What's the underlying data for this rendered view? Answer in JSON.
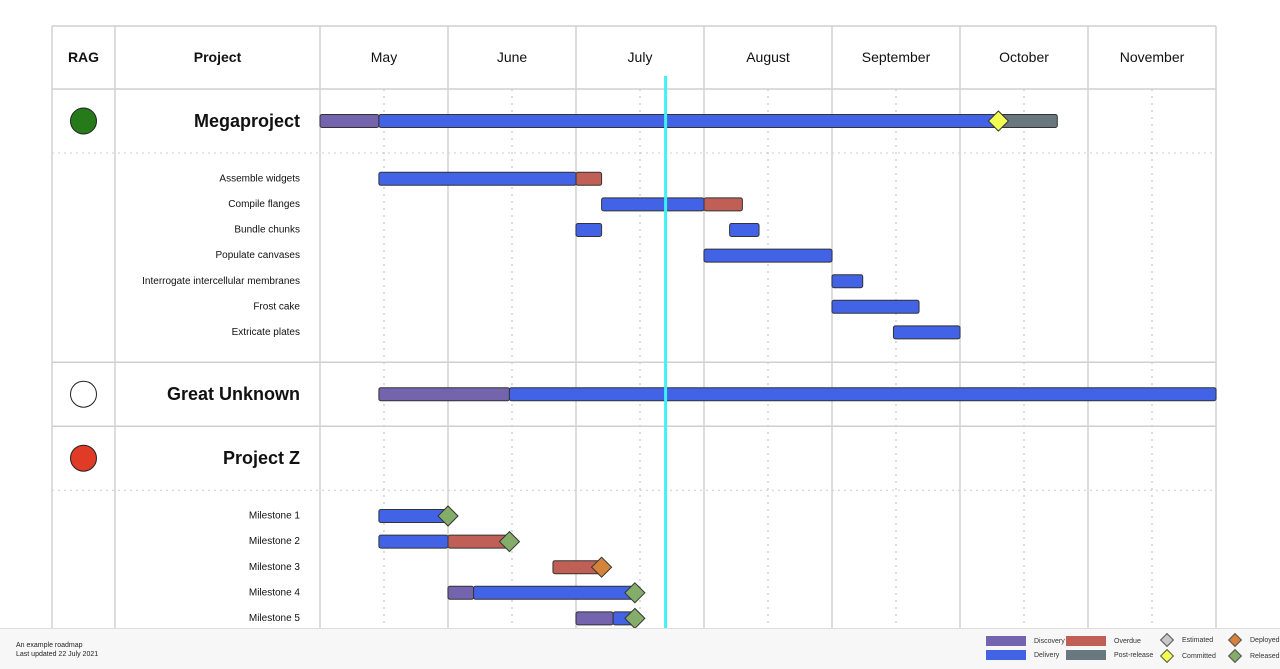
{
  "header": {
    "rag_label": "RAG",
    "project_label": "Project"
  },
  "chart_data": {
    "type": "gantt",
    "title": "",
    "months": [
      "May",
      "June",
      "July",
      "August",
      "September",
      "October",
      "November"
    ],
    "today_month_offset": 2.7,
    "phase_colors": {
      "discovery": "#7463ad",
      "delivery": "#4363e6",
      "overdue": "#c05f55",
      "post-release": "#69777f"
    },
    "milestone_colors": {
      "estimated": "#c8c8c8",
      "committed": "#f2ff52",
      "deployed": "#d5823a",
      "released": "#84ad6a"
    },
    "rag_colors": {
      "green": "#267a1a",
      "none": "#ffffff",
      "red": "#df3b26"
    },
    "projects": [
      {
        "name": "Megaproject",
        "rag": "green",
        "segments": [
          {
            "phase": "discovery",
            "start": 0.0,
            "end": 0.46
          },
          {
            "phase": "delivery",
            "start": 0.46,
            "end": 5.3
          },
          {
            "phase": "post-release",
            "start": 5.3,
            "end": 5.76
          }
        ],
        "milestones": [
          {
            "type": "committed",
            "at": 5.3
          }
        ],
        "tasks": [
          {
            "name": "Assemble widgets",
            "segments": [
              {
                "phase": "delivery",
                "start": 0.46,
                "end": 2.0
              },
              {
                "phase": "overdue",
                "start": 2.0,
                "end": 2.2
              }
            ],
            "milestones": []
          },
          {
            "name": "Compile flanges",
            "segments": [
              {
                "phase": "delivery",
                "start": 2.2,
                "end": 3.0
              },
              {
                "phase": "overdue",
                "start": 3.0,
                "end": 3.3
              }
            ],
            "milestones": []
          },
          {
            "name": "Bundle chunks",
            "segments": [
              {
                "phase": "delivery",
                "start": 2.0,
                "end": 2.2
              },
              {
                "phase": "delivery",
                "start": 3.2,
                "end": 3.43
              }
            ],
            "milestones": []
          },
          {
            "name": "Populate canvases",
            "segments": [
              {
                "phase": "delivery",
                "start": 3.0,
                "end": 4.0
              }
            ],
            "milestones": []
          },
          {
            "name": "Interrogate intercellular membranes",
            "segments": [
              {
                "phase": "delivery",
                "start": 4.0,
                "end": 4.24
              }
            ],
            "milestones": []
          },
          {
            "name": "Frost cake",
            "segments": [
              {
                "phase": "delivery",
                "start": 4.0,
                "end": 4.68
              }
            ],
            "milestones": []
          },
          {
            "name": "Extricate plates",
            "segments": [
              {
                "phase": "delivery",
                "start": 4.48,
                "end": 5.0
              }
            ],
            "milestones": []
          }
        ]
      },
      {
        "name": "Great Unknown",
        "rag": "none",
        "segments": [
          {
            "phase": "discovery",
            "start": 0.46,
            "end": 1.48
          },
          {
            "phase": "delivery",
            "start": 1.48,
            "end": 7.0
          }
        ],
        "milestones": [],
        "tasks": []
      },
      {
        "name": "Project Z",
        "rag": "red",
        "segments": [],
        "milestones": [],
        "tasks": [
          {
            "name": "Milestone 1",
            "segments": [
              {
                "phase": "delivery",
                "start": 0.46,
                "end": 1.0
              }
            ],
            "milestones": [
              {
                "type": "released",
                "at": 1.0
              }
            ]
          },
          {
            "name": "Milestone 2",
            "segments": [
              {
                "phase": "delivery",
                "start": 0.46,
                "end": 1.0
              },
              {
                "phase": "overdue",
                "start": 1.0,
                "end": 1.48
              }
            ],
            "milestones": [
              {
                "type": "released",
                "at": 1.48
              }
            ]
          },
          {
            "name": "Milestone 3",
            "segments": [
              {
                "phase": "overdue",
                "start": 1.82,
                "end": 2.2
              }
            ],
            "milestones": [
              {
                "type": "deployed",
                "at": 2.2
              }
            ]
          },
          {
            "name": "Milestone 4",
            "segments": [
              {
                "phase": "discovery",
                "start": 1.0,
                "end": 1.2
              },
              {
                "phase": "delivery",
                "start": 1.2,
                "end": 2.46
              }
            ],
            "milestones": [
              {
                "type": "released",
                "at": 2.46
              }
            ]
          },
          {
            "name": "Milestone 5",
            "segments": [
              {
                "phase": "discovery",
                "start": 2.0,
                "end": 2.29
              },
              {
                "phase": "delivery",
                "start": 2.29,
                "end": 2.46
              }
            ],
            "milestones": [
              {
                "type": "released",
                "at": 2.46
              }
            ]
          }
        ]
      }
    ]
  },
  "footer": {
    "line1": "An example roadmap",
    "line2": "Last updated 22 July 2021"
  },
  "legend": {
    "discovery": "Discovery",
    "delivery": "Delivery",
    "overdue": "Overdue",
    "post_release": "Post-release",
    "estimated": "Estimated",
    "committed": "Committed",
    "deployed": "Deployed",
    "released": "Released"
  }
}
